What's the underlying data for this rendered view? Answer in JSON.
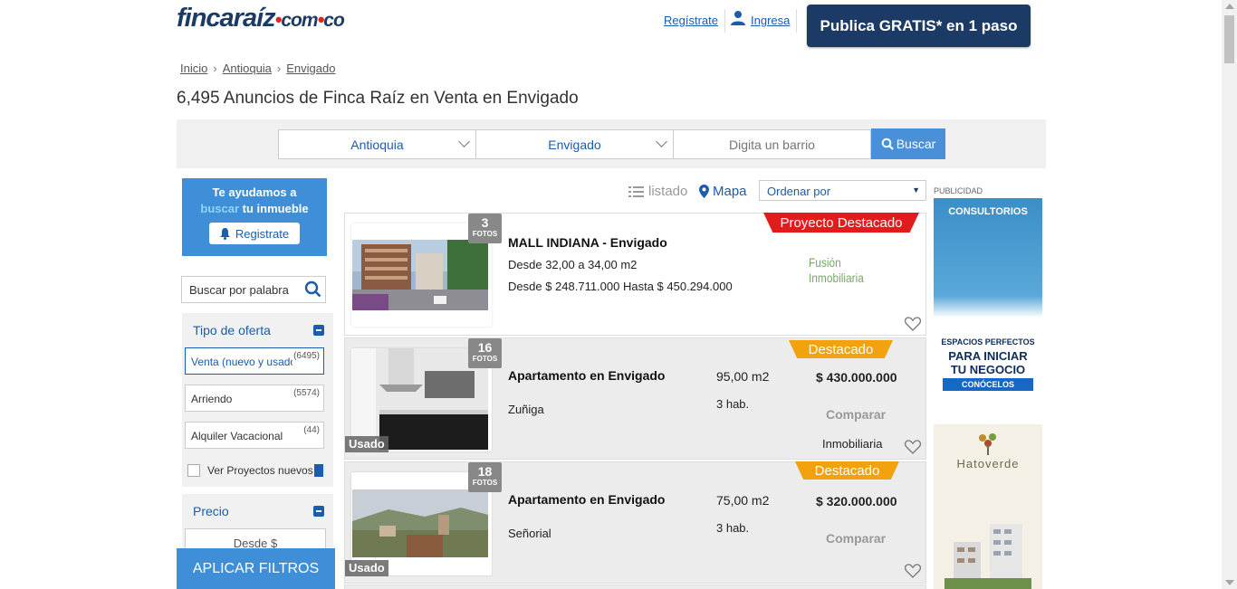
{
  "header": {
    "logo_main": "fincaraíz",
    "logo_com": "com",
    "logo_co": "co",
    "register_link": "Regístrate",
    "login_link": "Ingresa",
    "publish_button": "Publica GRATIS* en 1 paso"
  },
  "breadcrumb": [
    "Inicio",
    "Antioquia",
    "Envigado"
  ],
  "page_title": "6,495 Anuncios de Finca Raíz en Venta en Envigado",
  "search": {
    "department": "Antioquia",
    "city": "Envigado",
    "neighborhood_placeholder": "Digita un barrio",
    "search_button": "Buscar"
  },
  "sidebar": {
    "help_line1": "Te ayudamos a",
    "help_highlight": "buscar",
    "help_line2": "tu inmueble",
    "register_button": "Registrate",
    "keyword_placeholder": "Buscar por palabra",
    "offer_title": "Tipo de oferta",
    "offers": [
      {
        "label": "Venta (nuevo y usado)",
        "count": "(6495)"
      },
      {
        "label": "Arriendo",
        "count": "(5574)"
      },
      {
        "label": "Alquiler Vacacional",
        "count": "(44)"
      }
    ],
    "projects_label": "Ver Proyectos nuevos",
    "price_title": "Precio",
    "price_from_placeholder": "Desde $",
    "apply_button": "APLICAR FILTROS"
  },
  "toolbar": {
    "list_view": "listado",
    "map_view": "Mapa",
    "sort_label": "Ordenar por"
  },
  "listings": [
    {
      "photos": "3",
      "photos_label": "FOTOS",
      "badge": "Proyecto Destacado",
      "title": "MALL INDIANA - Envigado",
      "line1": "Desde 32,00 a 34,00 m2",
      "line2": "Desde $ 248.711.000 Hasta $ 450.294.000",
      "brand": "Fusión Inmobiliaria"
    },
    {
      "photos": "16",
      "photos_label": "FOTOS",
      "badge": "Destacado",
      "condition": "Usado",
      "title": "Apartamento en Envigado",
      "area": "95,00 m2",
      "price": "$ 430.000.000",
      "neighborhood": "Zuñiga",
      "rooms": "3 hab.",
      "compare": "Comparar",
      "seller": "Inmobiliaria"
    },
    {
      "photos": "18",
      "photos_label": "FOTOS",
      "badge": "Destacado",
      "condition": "Usado",
      "title": "Apartamento en Envigado",
      "area": "75,00 m2",
      "price": "$ 320.000.000",
      "neighborhood": "Señorial",
      "rooms": "3 hab.",
      "compare": "Comparar"
    }
  ],
  "ads": {
    "label": "PUBLICIDAD",
    "ad1_title": "CONSULTORIOS",
    "ad1_sub": "ESPACIOS PERFECTOS",
    "ad1_main1": "PARA INICIAR",
    "ad1_main2": "TU NEGOCIO",
    "ad1_button": "CONÓCELOS",
    "ad2_title": "Hatoverde"
  }
}
